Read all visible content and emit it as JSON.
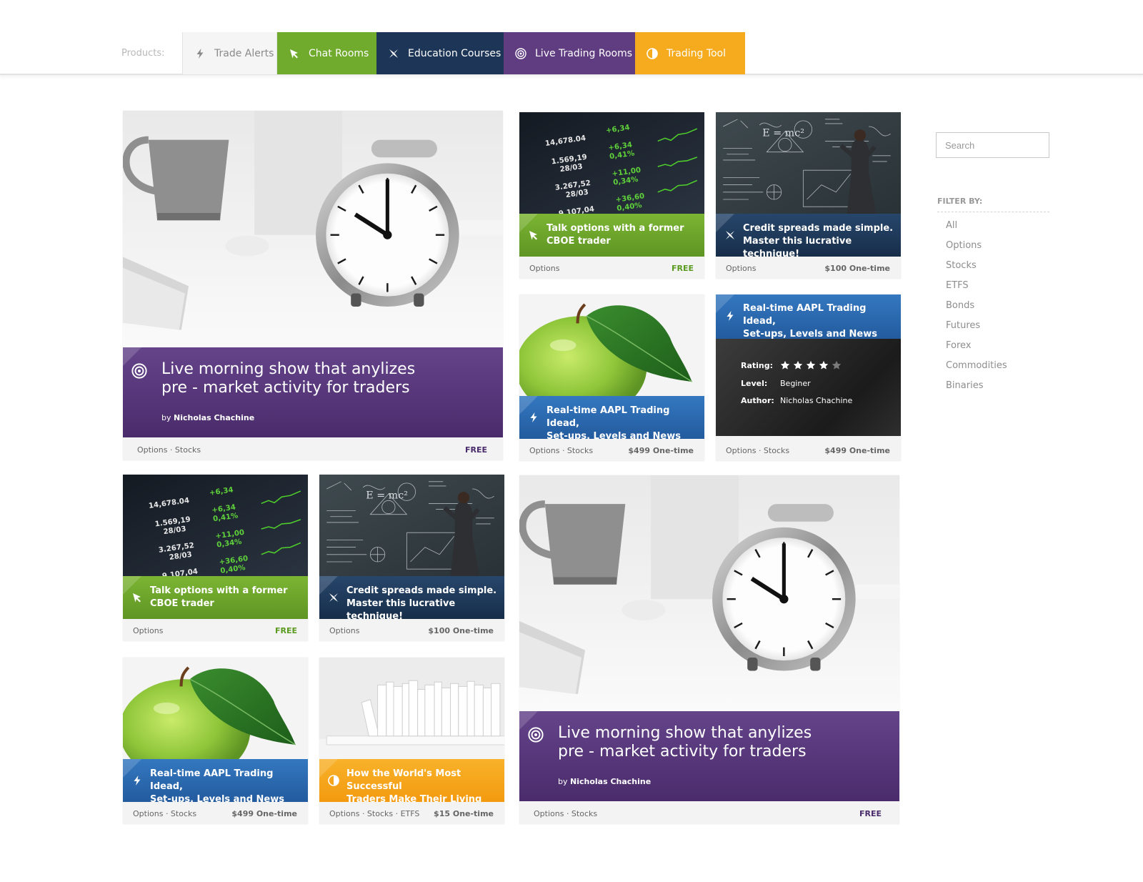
{
  "nav": {
    "label": "Products:",
    "tabs": [
      {
        "label": "Trade Alerts",
        "icon": "bolt-icon"
      },
      {
        "label": "Chat Rooms",
        "icon": "cursor-icon"
      },
      {
        "label": "Education Courses",
        "icon": "compass-icon"
      },
      {
        "label": "Live Trading Rooms",
        "icon": "target-icon"
      },
      {
        "label": "Trading Tool",
        "icon": "pie-icon"
      }
    ]
  },
  "cards": {
    "c1": {
      "title": "Live morning show that anylizes\npre - market activity for traders",
      "by": "by",
      "author": "Nicholas Chachine",
      "tags": "Options  · Stocks",
      "price": "FREE"
    },
    "c2": {
      "title": "Talk options with a former\nCBOE trader",
      "tags": "Options",
      "price": "FREE"
    },
    "c3": {
      "title": "Credit spreads made simple.\nMaster this lucrative technique!",
      "tags": "Options",
      "price": "$100 One-time"
    },
    "c4": {
      "title": "Real-time AAPL Trading Idead,\nSet-ups, Levels and News",
      "tags": "Options  · Stocks",
      "price": "$499 One-time"
    },
    "c5": {
      "title": "Real-time AAPL Trading Idead,\nSet-ups, Levels and News",
      "rating_label": "Rating:",
      "rating": 4,
      "rating_max": 5,
      "level_label": "Level:",
      "level": "Beginer",
      "author_label": "Author:",
      "author": "Nicholas Chachine",
      "tags": "Options  · Stocks",
      "price": "$499 One-time"
    },
    "c6": {
      "title": "Talk options with a former\nCBOE trader",
      "tags": "Options",
      "price": "FREE"
    },
    "c7": {
      "title": "Credit spreads made simple.\nMaster this lucrative technique!",
      "tags": "Options",
      "price": "$100 One-time"
    },
    "c8": {
      "title": "Live morning show that anylizes\npre - market activity for traders",
      "by": "by",
      "author": "Nicholas Chachine",
      "tags": "Options  · Stocks",
      "price": "FREE"
    },
    "c9": {
      "title": "Real-time AAPL Trading Idead,\nSet-ups, Levels and News",
      "tags": "Options  · Stocks",
      "price": "$499 One-time"
    },
    "c10": {
      "title": "How the World's Most Successful\nTraders Make Their Living",
      "tags": "Options  · Stocks  ·  ETFS",
      "price": "$15 One-time"
    }
  },
  "sidebar": {
    "search_placeholder": "Search",
    "filter_title": "FILTER BY:",
    "filters": [
      "All",
      "Options",
      "Stocks",
      "ETFS",
      "Bonds",
      "Futures",
      "Forex",
      "Commodities",
      "Binaries"
    ]
  },
  "colors": {
    "green": "#70ab2e",
    "navy": "#1d3657",
    "purple": "#603c80",
    "orange": "#f6ab1e",
    "blue": "#2a68ae"
  }
}
